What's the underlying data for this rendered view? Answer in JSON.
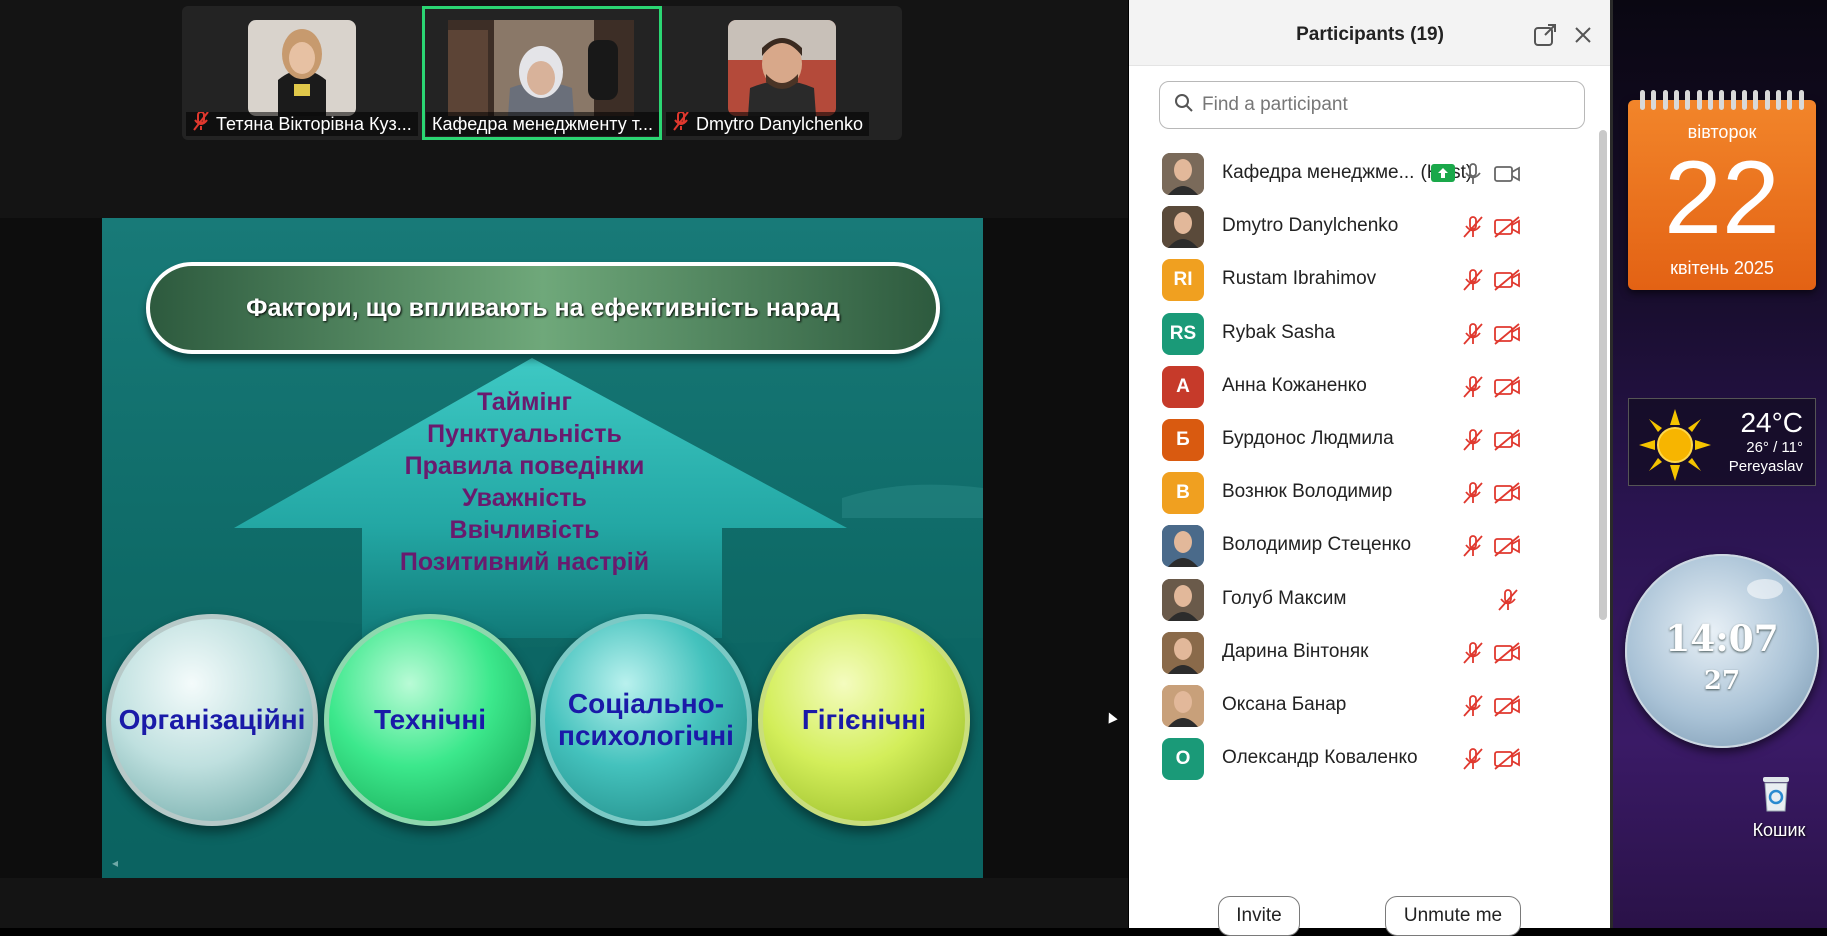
{
  "thumbnails": [
    {
      "name": "Тетяна Вікторівна Куз...",
      "muted": true,
      "active": false
    },
    {
      "name": "Кафедра менеджменту т...",
      "muted": false,
      "active": true
    },
    {
      "name": "Dmytro Danylchenko",
      "muted": true,
      "active": false
    }
  ],
  "slide": {
    "title": "Фактори, що впливають на ефективність нарад",
    "factors": [
      "Таймінг",
      "Пунктуальність",
      "Правила поведінки",
      "Уважність",
      "Ввічливість",
      "Позитивний настрій"
    ],
    "categories": [
      "Організаційні",
      "Технічні",
      "Соціально-психологічні",
      "Гігієнічні"
    ],
    "category_lines": [
      [
        "Організаційні"
      ],
      [
        "Технічні"
      ],
      [
        "Соціально-",
        "психологічні"
      ],
      [
        "Гігієнічні"
      ]
    ]
  },
  "participants_panel": {
    "title": "Participants (19)",
    "search_placeholder": "Find a participant",
    "invite_label": "Invite",
    "unmute_label": "Unmute me"
  },
  "participants": [
    {
      "name": "Кафедра менеджме...",
      "suffix": "(Host)",
      "initials": "",
      "color": "#7a6a5a",
      "photo": true,
      "mic": "on",
      "video": "on",
      "sharing": true
    },
    {
      "name": "Dmytro Danylchenko",
      "initials": "",
      "color": "#5a4a3a",
      "photo": true,
      "mic": "muted",
      "video": "off"
    },
    {
      "name": "Rustam Ibrahimov",
      "initials": "RI",
      "color": "#f0a020",
      "photo": false,
      "mic": "muted",
      "video": "off"
    },
    {
      "name": "Rybak Sasha",
      "initials": "RS",
      "color": "#1a9a78",
      "photo": false,
      "mic": "muted",
      "video": "off"
    },
    {
      "name": "Анна Кожаненко",
      "initials": "А",
      "color": "#c63a2a",
      "photo": false,
      "mic": "muted",
      "video": "off"
    },
    {
      "name": "Бурдонос Людмила",
      "initials": "Б",
      "color": "#d95a10",
      "photo": false,
      "mic": "muted",
      "video": "off"
    },
    {
      "name": "Вознюк Володимир",
      "initials": "В",
      "color": "#f0a020",
      "photo": false,
      "mic": "muted",
      "video": "off"
    },
    {
      "name": "Володимир Стеценко",
      "initials": "",
      "color": "#4a6a8a",
      "photo": true,
      "mic": "muted",
      "video": "off"
    },
    {
      "name": "Голуб Максим",
      "initials": "",
      "color": "#6a5a4a",
      "photo": true,
      "mic": "muted-only",
      "video": "none"
    },
    {
      "name": "Дарина Вінтоняк",
      "initials": "",
      "color": "#8a6a4a",
      "photo": true,
      "mic": "muted",
      "video": "off"
    },
    {
      "name": "Оксана Банар",
      "initials": "",
      "color": "#c8a07a",
      "photo": true,
      "mic": "muted",
      "video": "off"
    },
    {
      "name": "Олександр Коваленко",
      "initials": "О",
      "color": "#1a9a78",
      "photo": false,
      "mic": "muted",
      "video": "off"
    }
  ],
  "desktop": {
    "calendar": {
      "weekday": "вівторок",
      "day": "22",
      "month_year": "квітень 2025"
    },
    "weather": {
      "temp": "24°C",
      "range": "26° / 11°",
      "city": "Pereyaslav"
    },
    "clock": {
      "time": "14:07",
      "seconds": "27"
    },
    "recycle_bin_label": "Кошик"
  },
  "colors": {
    "active_speaker": "#2bd673",
    "mute_red": "#e0382e",
    "calendar_orange": "#e36214",
    "share_green": "#1aa84a"
  }
}
